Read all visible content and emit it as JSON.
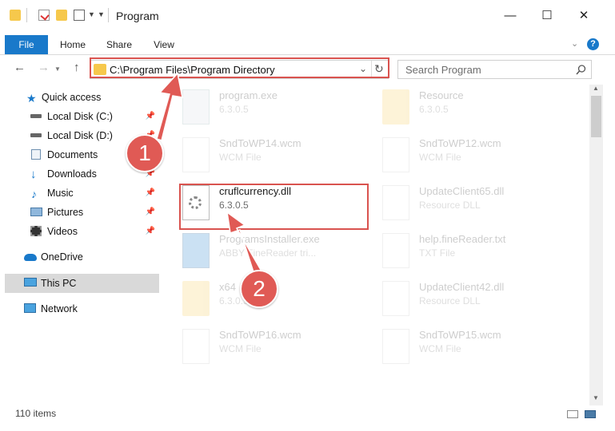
{
  "window": {
    "title": "Program",
    "minimize": "—",
    "maximize": "☐",
    "close": "✕"
  },
  "ribbon": {
    "tabs": [
      "File",
      "Home",
      "Share",
      "View"
    ],
    "help": "?"
  },
  "nav": {
    "back": "←",
    "forward": "→",
    "up": "↑",
    "address": "C:\\Program Files\\Program Directory",
    "search_placeholder": "Search Program"
  },
  "sidebar": {
    "items": [
      {
        "label": "Quick access",
        "icon": "star-icon"
      },
      {
        "label": "Local Disk (C:)",
        "icon": "drive-icon"
      },
      {
        "label": "Local Disk (D:)",
        "icon": "drive-icon"
      },
      {
        "label": "Documents",
        "icon": "documents-icon"
      },
      {
        "label": "Downloads",
        "icon": "download-icon"
      },
      {
        "label": "Music",
        "icon": "music-icon"
      },
      {
        "label": "Pictures",
        "icon": "pictures-icon"
      },
      {
        "label": "Videos",
        "icon": "videos-icon"
      },
      {
        "label": "OneDrive",
        "icon": "cloud-icon"
      },
      {
        "label": "This PC",
        "icon": "computer-icon"
      },
      {
        "label": "Network",
        "icon": "network-icon"
      }
    ]
  },
  "files": [
    {
      "name": "program.exe",
      "sub": "6.3.0.5"
    },
    {
      "name": "Resource",
      "sub": "6.3.0.5"
    },
    {
      "name": "SndToWP14.wcm",
      "sub": "WCM File"
    },
    {
      "name": "SndToWP12.wcm",
      "sub": "WCM File"
    },
    {
      "name": "cruflcurrency.dll",
      "sub": "6.3.0.5"
    },
    {
      "name": "UpdateClient65.dll",
      "sub": "Resource DLL"
    },
    {
      "name": "ProgramsInstaller.exe",
      "sub": "ABBY FineReader tri..."
    },
    {
      "name": "help.fineReader.txt",
      "sub": "TXT File"
    },
    {
      "name": "x64",
      "sub": "6.3.0.5"
    },
    {
      "name": "UpdateClient42.dll",
      "sub": "Resource DLL"
    },
    {
      "name": "SndToWP16.wcm",
      "sub": "WCM File"
    },
    {
      "name": "SndToWP15.wcm",
      "sub": "WCM File"
    }
  ],
  "status": {
    "count": "110 items"
  },
  "annotations": {
    "step1": "1",
    "step2": "2"
  },
  "colors": {
    "accent": "#1979ca",
    "highlight": "#d9534f",
    "badge": "#e05a55",
    "folder": "#f6c84c"
  }
}
